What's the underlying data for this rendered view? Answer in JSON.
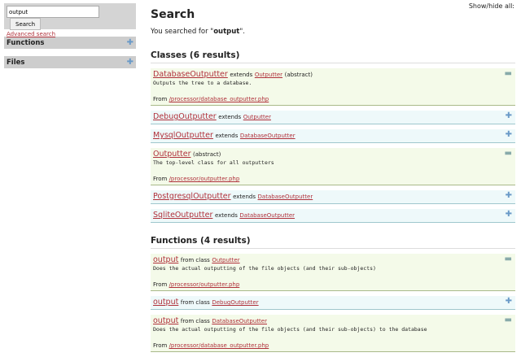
{
  "sidebar": {
    "search_value": "output",
    "search_button": "Search",
    "advanced": "Advanced search",
    "sections": [
      {
        "label": "Functions"
      },
      {
        "label": "Files"
      }
    ]
  },
  "main": {
    "title": "Search",
    "searched_prefix": "You searched for \"",
    "query": "output",
    "searched_suffix": "\".",
    "show_hide": "Show/hide all:",
    "classes_heading": "Classes (6 results)",
    "classes": [
      {
        "name": "DatabaseOutputter",
        "rel": "extends",
        "parent": "Outputter",
        "suffix": "(abstract)",
        "desc": "Outputs the tree to a database.",
        "from": "From",
        "file": "/processor/database_outputter.php",
        "open": true
      },
      {
        "name": "DebugOutputter",
        "rel": "extends",
        "parent": "Outputter",
        "open": false
      },
      {
        "name": "MysqlOutputter",
        "rel": "extends",
        "parent": "DatabaseOutputter",
        "open": false
      },
      {
        "name": "Outputter",
        "suffix": "(abstract)",
        "desc": "The top-level class for all outputters",
        "from": "From",
        "file": "/processor/outputter.php",
        "open": true
      },
      {
        "name": "PostgresqlOutputter",
        "rel": "extends",
        "parent": "DatabaseOutputter",
        "open": false
      },
      {
        "name": "SqliteOutputter",
        "rel": "extends",
        "parent": "DatabaseOutputter",
        "open": false
      }
    ],
    "functions_heading": "Functions (4 results)",
    "functions": [
      {
        "name": "output",
        "rel": "from class",
        "parent": "Outputter",
        "desc": "Does the actual outputting of the file objects (and their sub-objects)",
        "from": "From",
        "file": "/processor/outputter.php",
        "open": true
      },
      {
        "name": "output",
        "rel": "from class",
        "parent": "DebugOutputter",
        "open": false
      },
      {
        "name": "output",
        "rel": "from class",
        "parent": "DatabaseOutputter",
        "desc": "Does the actual outputting of the file objects (and their sub-objects) to the database",
        "from": "From",
        "file": "/processor/database_outputter.php",
        "open": true
      }
    ]
  }
}
